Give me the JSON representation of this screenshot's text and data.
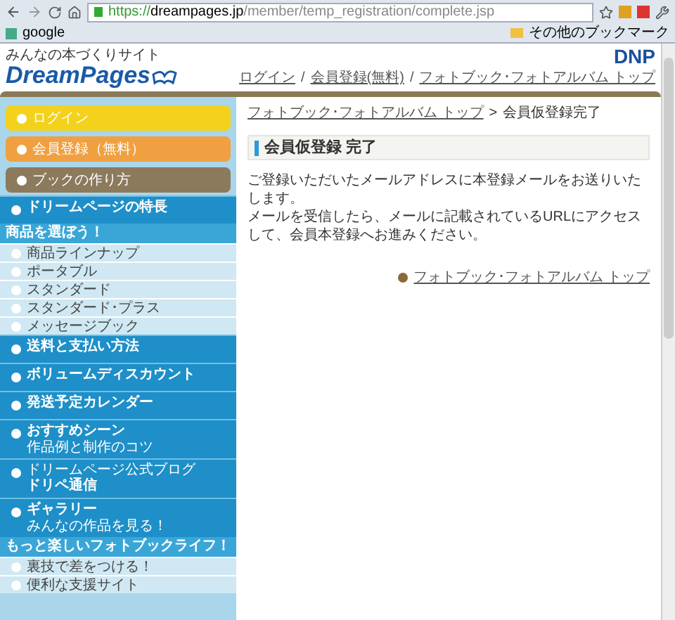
{
  "browser": {
    "url_scheme": "https://",
    "url_host": "dreampages.jp",
    "url_path": "/member/temp_registration/complete.jsp",
    "bookmarks": [
      {
        "label": "google"
      }
    ],
    "other_bookmarks": "その他のブックマーク"
  },
  "header": {
    "tagline": "みんなの本づくりサイト",
    "logo": "DreamPages",
    "brand": "DNP",
    "nav_separator": "/",
    "nav": [
      "ログイン",
      "会員登録(無料)",
      "フォトブック･フォトアルバム トップ"
    ]
  },
  "sidebar": [
    {
      "kind": "button",
      "label": "ログイン",
      "color": "#f2d21c"
    },
    {
      "kind": "button",
      "label": "会員登録（無料）",
      "color": "#f0a040"
    },
    {
      "kind": "button",
      "label": "ブックの作り方",
      "color": "#8c7a5c"
    },
    {
      "kind": "section",
      "label": "ドリームページの特長"
    },
    {
      "kind": "header",
      "label": "商品を選ぼう！"
    },
    {
      "kind": "sub",
      "label": "商品ラインナップ"
    },
    {
      "kind": "sub",
      "label": "ポータブル"
    },
    {
      "kind": "sub",
      "label": "スタンダード"
    },
    {
      "kind": "sub",
      "label": "スタンダード･プラス"
    },
    {
      "kind": "sub",
      "label": "メッセージブック"
    },
    {
      "kind": "section",
      "label": "送料と支払い方法"
    },
    {
      "kind": "section",
      "label": "ボリュームディスカウント"
    },
    {
      "kind": "section",
      "label": "発送予定カレンダー"
    },
    {
      "kind": "section",
      "label": "おすすめシーン",
      "note": "作品例と制作のコツ"
    },
    {
      "kind": "section",
      "pre": "ドリームページ公式ブログ",
      "label": "ドリペ通信"
    },
    {
      "kind": "section",
      "label": "ギャラリー",
      "note": "みんなの作品を見る！"
    },
    {
      "kind": "header",
      "label": "もっと楽しいフォトブックライフ！"
    },
    {
      "kind": "sub",
      "label": "裏技で差をつける！"
    },
    {
      "kind": "sub",
      "label": "便利な支援サイト"
    }
  ],
  "main": {
    "breadcrumb": {
      "link": "フォトブック･フォトアルバム トップ",
      "separator": ">",
      "current": "会員仮登録完了"
    },
    "title": "会員仮登録 完了",
    "paragraphs": [
      "ご登録いただいたメールアドレスに本登録メールをお送りいたします。",
      "メールを受信したら、メールに記載されているURLにアクセスして、会員本登録へお進みください。"
    ],
    "link": "フォトブック･フォトアルバム トップ"
  }
}
